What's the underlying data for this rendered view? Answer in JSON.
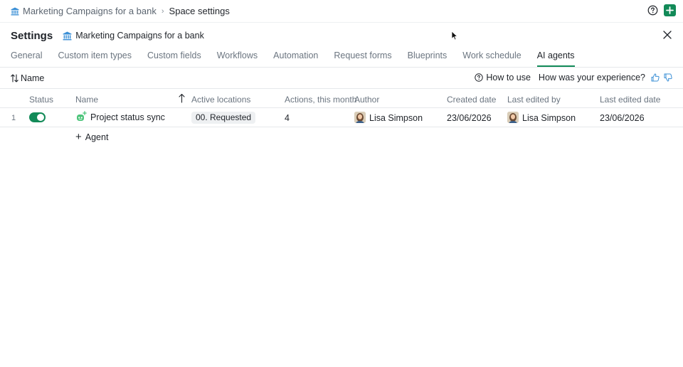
{
  "breadcrumb": {
    "space": "Marketing Campaigns for a bank",
    "current": "Space settings"
  },
  "header": {
    "title": "Settings",
    "space_name": "Marketing Campaigns for a bank"
  },
  "tabs": [
    {
      "label": "General",
      "active": false
    },
    {
      "label": "Custom item types",
      "active": false
    },
    {
      "label": "Custom fields",
      "active": false
    },
    {
      "label": "Workflows",
      "active": false
    },
    {
      "label": "Automation",
      "active": false
    },
    {
      "label": "Request forms",
      "active": false
    },
    {
      "label": "Blueprints",
      "active": false
    },
    {
      "label": "Work schedule",
      "active": false
    },
    {
      "label": "AI agents",
      "active": true
    }
  ],
  "toolbar": {
    "sort_label": "Name",
    "how_to_use": "How to use",
    "feedback": "How was your experience?"
  },
  "table": {
    "columns": {
      "status": "Status",
      "name": "Name",
      "active_locations": "Active locations",
      "actions": "Actions, this month",
      "author": "Author",
      "created": "Created date",
      "last_edited_by": "Last edited by",
      "last_edited": "Last edited date"
    },
    "rows": [
      {
        "index": "1",
        "status_on": true,
        "name": "Project status sync",
        "location": "00. Requested",
        "actions": "4",
        "author": "Lisa Simpson",
        "created": "23/06/2026",
        "last_edited_by": "Lisa Simpson",
        "last_edited": "23/06/2026"
      }
    ]
  },
  "add_agent_label": "Agent",
  "colors": {
    "accent": "#128a58",
    "bank_icon": "#3a8fd6",
    "agent_icon": "#4cc47a"
  },
  "icons": [
    "bank-icon",
    "chevron-right-icon",
    "help-icon",
    "plus-icon",
    "close-icon",
    "sort-icon",
    "question-icon",
    "thumbs-up-icon",
    "thumbs-down-icon",
    "arrow-up-icon",
    "robot-icon"
  ]
}
